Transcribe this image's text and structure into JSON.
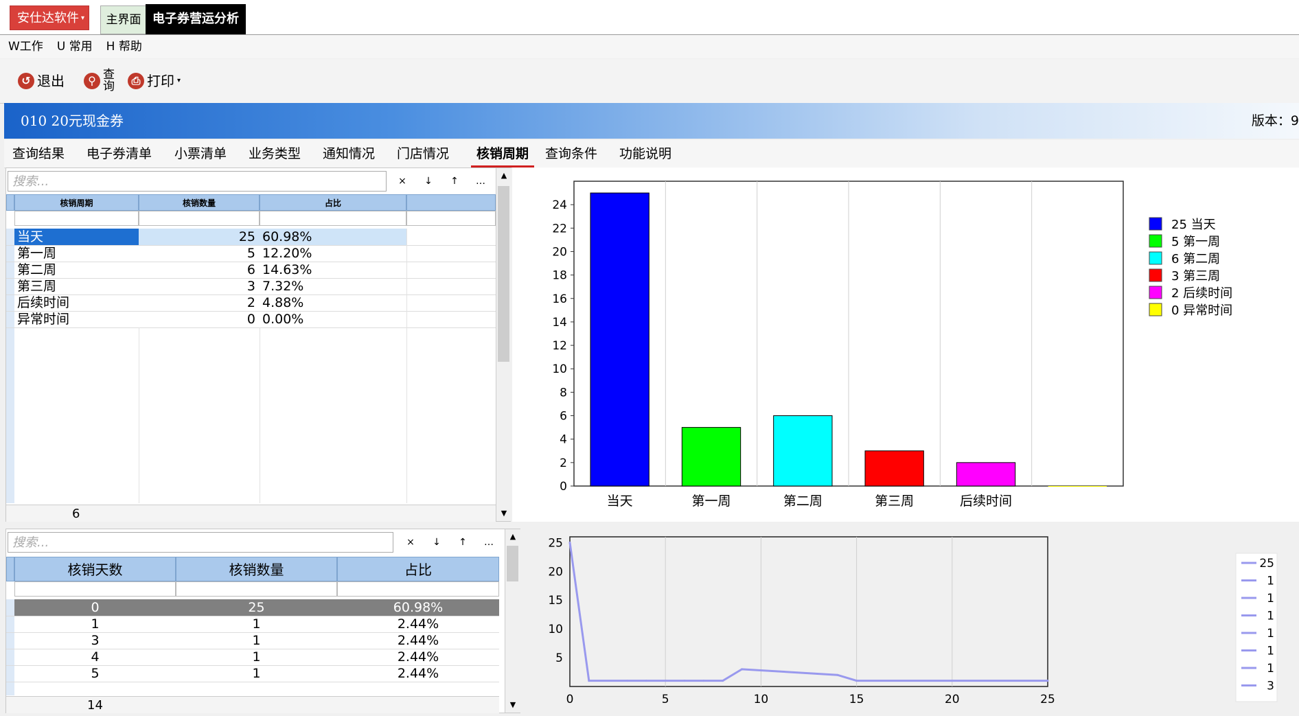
{
  "app": {
    "brand_label": "安仕达软件",
    "tab_main": "主界面",
    "tab_analysis": "电子券营运分析"
  },
  "menu": [
    "W工作",
    "U 常用",
    "H 帮助"
  ],
  "toolbar": {
    "exit": "退出",
    "query_1": "查",
    "query_2": "询",
    "print": "打印"
  },
  "banner": {
    "title": "010 20元现金券",
    "version": "版本：9"
  },
  "tabs": [
    "查询结果",
    "电子券清单",
    "小票清单",
    "业务类型",
    "通知情况",
    "门店情况",
    "核销周期",
    "查询条件",
    "功能说明"
  ],
  "active_tab": "核销周期",
  "top_grid": {
    "search_placeholder": "搜索...",
    "buttons": [
      "×",
      "↓",
      "↑",
      "…"
    ],
    "columns": [
      "核销周期",
      "核销数量",
      "占比"
    ],
    "rows": [
      [
        "当天",
        "25",
        "60.98%"
      ],
      [
        "第一周",
        "5",
        "12.20%"
      ],
      [
        "第二周",
        "6",
        "14.63%"
      ],
      [
        "第三周",
        "3",
        "7.32%"
      ],
      [
        "后续时间",
        "2",
        "4.88%"
      ],
      [
        "异常时间",
        "0",
        "0.00%"
      ]
    ],
    "footer_count": "6"
  },
  "bottom_grid": {
    "search_placeholder": "搜索...",
    "buttons": [
      "×",
      "↓",
      "↑",
      "…"
    ],
    "columns": [
      "核销天数",
      "核销数量",
      "占比"
    ],
    "rows": [
      [
        "0",
        "25",
        "60.98%"
      ],
      [
        "1",
        "1",
        "2.44%"
      ],
      [
        "3",
        "1",
        "2.44%"
      ],
      [
        "4",
        "1",
        "2.44%"
      ],
      [
        "5",
        "1",
        "2.44%"
      ]
    ],
    "footer_count": "14"
  },
  "chart_data": [
    {
      "type": "bar",
      "categories": [
        "当天",
        "第一周",
        "第二周",
        "第三周",
        "后续时间",
        "异常时间"
      ],
      "values": [
        25,
        5,
        6,
        3,
        2,
        0
      ],
      "colors": [
        "#0000ff",
        "#00ff00",
        "#00ffff",
        "#ff0000",
        "#ff00ff",
        "#ffff00"
      ],
      "x_tick_labels": [
        "当天",
        "第一周",
        "第二周",
        "第三周",
        "后续时间"
      ],
      "y_ticks": [
        0,
        2,
        4,
        6,
        8,
        10,
        12,
        14,
        16,
        18,
        20,
        22,
        24
      ],
      "ylim": [
        0,
        26
      ],
      "grid": "vertical",
      "legend": {
        "placement": "right",
        "entries": [
          "25 当天",
          "5 第一周",
          "6 第二周",
          "3 第三周",
          "2 后续时间",
          "0 异常时间"
        ]
      }
    },
    {
      "type": "line",
      "x": [
        0,
        1,
        3,
        4,
        5,
        6,
        7,
        8,
        9,
        14,
        15,
        25
      ],
      "y": [
        25,
        1,
        1,
        1,
        1,
        1,
        1,
        1,
        3,
        2,
        1,
        1
      ],
      "color": "#9999ee",
      "x_ticks": [
        0,
        5,
        10,
        15,
        20,
        25
      ],
      "y_ticks": [
        5,
        10,
        15,
        20,
        25
      ],
      "xlim": [
        0,
        25
      ],
      "ylim": [
        0,
        26
      ],
      "grid": "vertical",
      "legend": {
        "placement": "right",
        "entries": [
          "25",
          "1",
          "1",
          "1",
          "1",
          "1",
          "1",
          "3"
        ]
      }
    }
  ]
}
